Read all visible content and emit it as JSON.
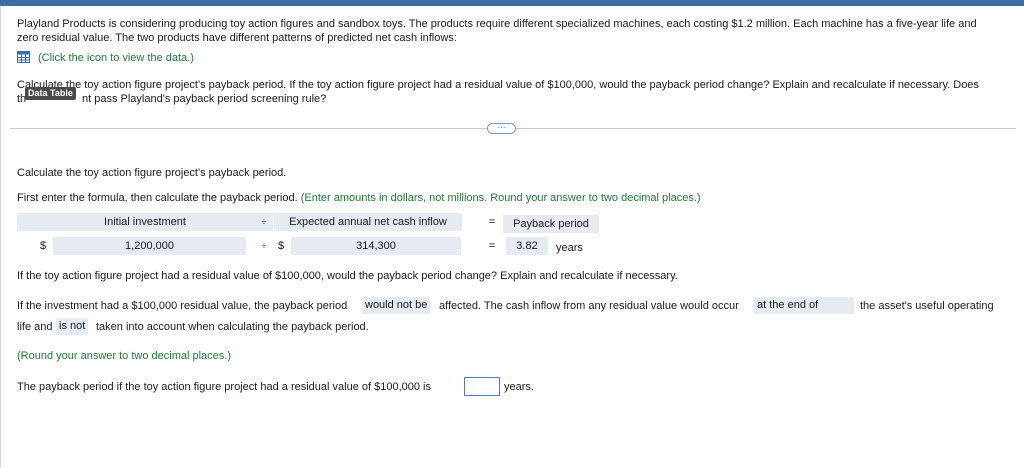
{
  "intro": {
    "line1": "Playland Products is considering producing toy action figures and sandbox toys. The products require different specialized machines, each costing $1.2 million. Each machine has a five-year life and",
    "line2": "zero residual value. The two products have different patterns of predicted net cash inflows:",
    "data_link": "(Click the icon to view the data.)"
  },
  "question": {
    "line1": "Calculate the toy action figure project's payback period. If the toy action figure project had a residual value of $100,000, would the payback period change? Explain and recalculate if necessary. Does",
    "line2_start": "th",
    "line2_end": "nt pass Playland's payback period screening rule?",
    "tooltip": "Data Table"
  },
  "expand_label": "···",
  "part1": {
    "heading": "Calculate the toy action figure project's payback period.",
    "instruction": "First enter the formula, then calculate the payback period.",
    "instruction_note": "(Enter amounts in dollars, not millions. Round your answer to two decimal places.)"
  },
  "formula": {
    "header_investment": "Initial investment",
    "op_divide": "÷",
    "header_inflow": "Expected annual net cash inflow",
    "op_equals": "=",
    "header_result": "Payback period",
    "dollar1": "$",
    "investment_value": "1,200,000",
    "dollar2": "$",
    "inflow_value": "314,300",
    "result_value": "3.82",
    "result_unit": "years"
  },
  "part2": {
    "question": "If the toy action figure project had a residual value of $100,000, would the payback period change? Explain and recalculate if necessary.",
    "s1": "If the investment had a $100,000 residual value, the payback period",
    "a1": "would not be",
    "s2": "affected. The cash inflow from any residual value would occur",
    "a2": "at the end of",
    "s3": "the asset's useful operating",
    "s4": "life and",
    "a3": "is not",
    "s5": "taken into account when calculating the payback period.",
    "round_note": "(Round your answer to two decimal places.)",
    "final_prompt": "The payback period if the toy action figure project had a residual value of $100,000 is",
    "final_value": "",
    "final_unit": "years."
  }
}
